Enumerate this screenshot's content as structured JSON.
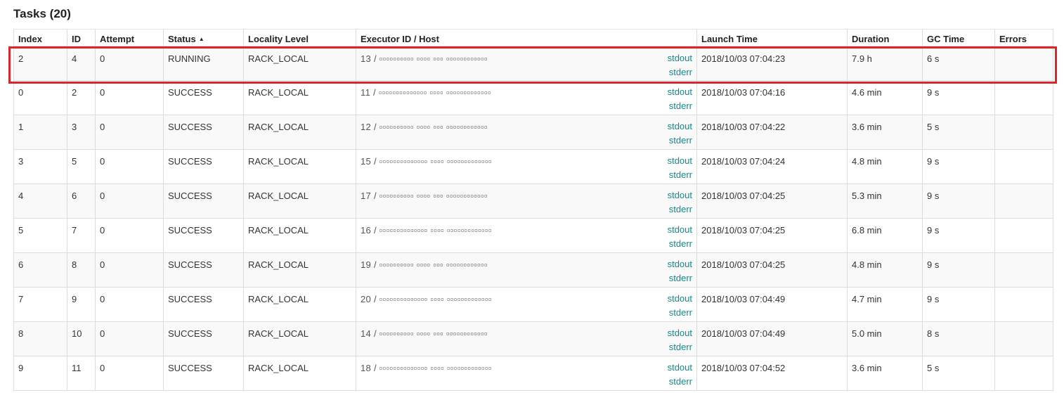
{
  "page": {
    "title": "Tasks (20)",
    "highlight_color": "#d9262d",
    "link_color": "#0f8b8d"
  },
  "table": {
    "headers": [
      "Index",
      "ID",
      "Attempt",
      "Status",
      "Locality Level",
      "Executor ID / Host",
      "Launch Time",
      "Duration",
      "GC Time",
      "Errors"
    ],
    "sort_indicator": "▲",
    "rows": [
      {
        "index": "2",
        "id": "4",
        "attempt": "0",
        "status": "RUNNING",
        "locality": "RACK_LOCAL",
        "executor": "13 / ▫▫▫▫▫▫▫▫▫▫ ▫▫▫▫ ▫▫▫ ▫▫▫▫▫▫▫▫▫▫▫▫",
        "stdout": "stdout",
        "stderr": "stderr",
        "launch": "2018/10/03 07:04:23",
        "duration": "7.9 h",
        "gc": "6 s",
        "errors": ""
      },
      {
        "index": "0",
        "id": "2",
        "attempt": "0",
        "status": "SUCCESS",
        "locality": "RACK_LOCAL",
        "executor": "11 / ▫▫▫▫▫▫▫▫▫▫▫▫▫▫ ▫▫▫▫ ▫▫▫▫▫▫▫▫▫▫▫▫▫",
        "stdout": "stdout",
        "stderr": "stderr",
        "launch": "2018/10/03 07:04:16",
        "duration": "4.6 min",
        "gc": "9 s",
        "errors": ""
      },
      {
        "index": "1",
        "id": "3",
        "attempt": "0",
        "status": "SUCCESS",
        "locality": "RACK_LOCAL",
        "executor": "12 / ▫▫▫▫▫▫▫▫▫▫ ▫▫▫▫ ▫▫▫ ▫▫▫▫▫▫▫▫▫▫▫▫",
        "stdout": "stdout",
        "stderr": "stderr",
        "launch": "2018/10/03 07:04:22",
        "duration": "3.6 min",
        "gc": "5 s",
        "errors": ""
      },
      {
        "index": "3",
        "id": "5",
        "attempt": "0",
        "status": "SUCCESS",
        "locality": "RACK_LOCAL",
        "executor": "15 / ▫▫▫▫▫▫▫▫▫▫▫▫▫▫ ▫▫▫▫ ▫▫▫▫▫▫▫▫▫▫▫▫▫",
        "stdout": "stdout",
        "stderr": "stderr",
        "launch": "2018/10/03 07:04:24",
        "duration": "4.8 min",
        "gc": "9 s",
        "errors": ""
      },
      {
        "index": "4",
        "id": "6",
        "attempt": "0",
        "status": "SUCCESS",
        "locality": "RACK_LOCAL",
        "executor": "17 / ▫▫▫▫▫▫▫▫▫▫ ▫▫▫▫ ▫▫▫ ▫▫▫▫▫▫▫▫▫▫▫▫",
        "stdout": "stdout",
        "stderr": "stderr",
        "launch": "2018/10/03 07:04:25",
        "duration": "5.3 min",
        "gc": "9 s",
        "errors": ""
      },
      {
        "index": "5",
        "id": "7",
        "attempt": "0",
        "status": "SUCCESS",
        "locality": "RACK_LOCAL",
        "executor": "16 / ▫▫▫▫▫▫▫▫▫▫▫▫▫▫ ▫▫▫▫ ▫▫▫▫▫▫▫▫▫▫▫▫▫",
        "stdout": "stdout",
        "stderr": "stderr",
        "launch": "2018/10/03 07:04:25",
        "duration": "6.8 min",
        "gc": "9 s",
        "errors": ""
      },
      {
        "index": "6",
        "id": "8",
        "attempt": "0",
        "status": "SUCCESS",
        "locality": "RACK_LOCAL",
        "executor": "19 / ▫▫▫▫▫▫▫▫▫▫ ▫▫▫▫ ▫▫▫ ▫▫▫▫▫▫▫▫▫▫▫▫",
        "stdout": "stdout",
        "stderr": "stderr",
        "launch": "2018/10/03 07:04:25",
        "duration": "4.8 min",
        "gc": "9 s",
        "errors": ""
      },
      {
        "index": "7",
        "id": "9",
        "attempt": "0",
        "status": "SUCCESS",
        "locality": "RACK_LOCAL",
        "executor": "20 / ▫▫▫▫▫▫▫▫▫▫▫▫▫▫ ▫▫▫▫ ▫▫▫▫▫▫▫▫▫▫▫▫▫",
        "stdout": "stdout",
        "stderr": "stderr",
        "launch": "2018/10/03 07:04:49",
        "duration": "4.7 min",
        "gc": "9 s",
        "errors": ""
      },
      {
        "index": "8",
        "id": "10",
        "attempt": "0",
        "status": "SUCCESS",
        "locality": "RACK_LOCAL",
        "executor": "14 / ▫▫▫▫▫▫▫▫▫▫ ▫▫▫▫ ▫▫▫ ▫▫▫▫▫▫▫▫▫▫▫▫",
        "stdout": "stdout",
        "stderr": "stderr",
        "launch": "2018/10/03 07:04:49",
        "duration": "5.0 min",
        "gc": "8 s",
        "errors": ""
      },
      {
        "index": "9",
        "id": "11",
        "attempt": "0",
        "status": "SUCCESS",
        "locality": "RACK_LOCAL",
        "executor": "18 / ▫▫▫▫▫▫▫▫▫▫▫▫▫▫ ▫▫▫▫ ▫▫▫▫▫▫▫▫▫▫▫▫▫",
        "stdout": "stdout",
        "stderr": "stderr",
        "launch": "2018/10/03 07:04:52",
        "duration": "3.6 min",
        "gc": "5 s",
        "errors": ""
      }
    ]
  }
}
